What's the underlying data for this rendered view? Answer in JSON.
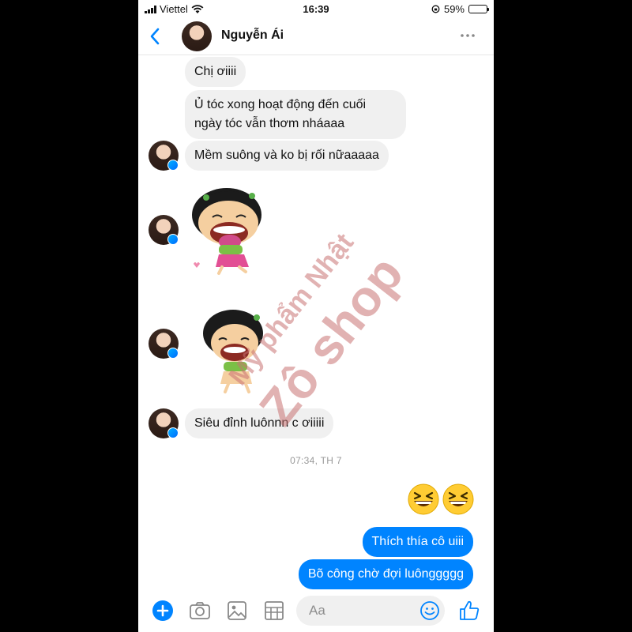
{
  "status": {
    "carrier": "Viettel",
    "time": "16:39",
    "battery": "59%",
    "battery_level": 0.59
  },
  "header": {
    "name": "Nguyễn Ái",
    "back_icon": "chevron-left-icon",
    "more_icon": "more-dots-icon"
  },
  "messages": [
    {
      "from": "them",
      "text": "Chị ơiiii"
    },
    {
      "from": "them",
      "text": "Ủ tóc xong hoạt động đến cuối ngày tóc vẫn thơm nháaaa"
    },
    {
      "from": "them",
      "text": "Mềm suông và ko bị rối nữaaaaa"
    },
    {
      "from": "them",
      "type": "sticker"
    },
    {
      "from": "them",
      "type": "sticker"
    },
    {
      "from": "them",
      "text": "Siêu đỉnh luônnn c ơiiiii"
    },
    {
      "from": "me",
      "text": "Thích thía cô uiii"
    },
    {
      "from": "me",
      "text": "Bõ công chờ đợi luônggggg"
    }
  ],
  "timestamp": "07:34, TH 7",
  "watermark": {
    "line1": "Mỹ phẩm Nhật",
    "line2": "Zô shop"
  },
  "composer": {
    "placeholder": "Aa"
  },
  "colors": {
    "accent": "#0084ff",
    "incoming_bubble": "#f0f0f0",
    "watermark": "#c97272"
  }
}
